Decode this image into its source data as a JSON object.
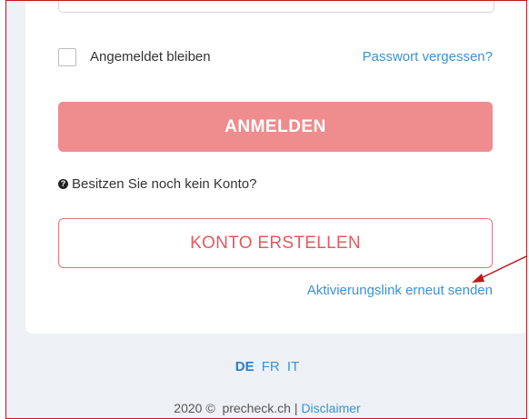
{
  "form": {
    "remember_label": "Angemeldet bleiben",
    "remember_checked": false,
    "forgot_password": "Passwort vergessen?",
    "login_button": "ANMELDEN",
    "no_account_text": "Besitzen Sie noch kein Konto?",
    "create_account_button": "KONTO ERSTELLEN",
    "resend_activation": "Aktivierungslink erneut senden"
  },
  "languages": [
    {
      "code": "DE",
      "active": true
    },
    {
      "code": "FR",
      "active": false
    },
    {
      "code": "IT",
      "active": false
    }
  ],
  "footer": {
    "year_copyright": "2020 ©",
    "site": "precheck.ch",
    "separator": "|",
    "disclaimer": "Disclaimer"
  },
  "colors": {
    "login_button_bg": "#ef8c8e",
    "create_button_text": "#e05a60",
    "link": "#3a92d4",
    "page_background": "#edf1f5",
    "annotation_arrow": "#c01818"
  },
  "icons": {
    "no_account": "question-circle-icon"
  }
}
